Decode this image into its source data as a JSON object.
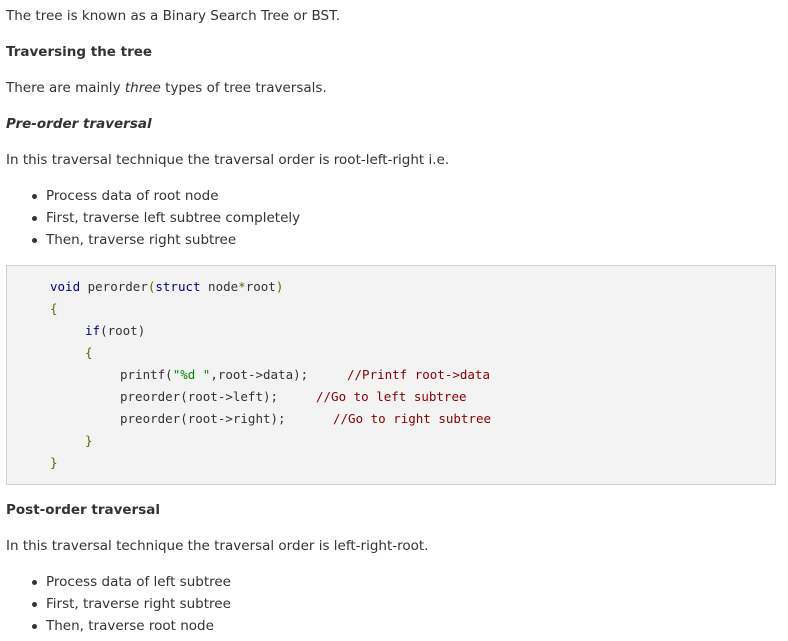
{
  "intro": {
    "text": "The tree is known as a Binary Search Tree or BST."
  },
  "traversing": {
    "heading": "Traversing the tree",
    "text_before": "There are mainly ",
    "text_em": "three",
    "text_after": " types of tree traversals."
  },
  "preorder": {
    "heading": "Pre-order traversal",
    "description": "In this traversal technique the traversal order is root-left-right i.e.",
    "bullets": [
      "Process data of root node",
      "First, traverse left subtree completely",
      "Then, traverse right subtree"
    ]
  },
  "code": {
    "sig_kw": "void",
    "sig_name": " perorder",
    "sig_paren_open": "(",
    "sig_struct": "struct",
    "sig_params": " node",
    "sig_star": "*",
    "sig_root": "root",
    "sig_paren_close": ")",
    "brace_open": "{",
    "if_kw": "if",
    "if_cond": "(root)",
    "inner_brace_open": "{",
    "printf_call": "printf(",
    "printf_str": "\"%d \"",
    "printf_args": ",root->data);",
    "printf_comment": "//Printf root->data",
    "left_call": "preorder(root->left);",
    "left_comment": "//Go to left subtree",
    "right_call": "preorder(root->right);",
    "right_comment": "//Go to right subtree",
    "inner_brace_close": "}",
    "brace_close": "}"
  },
  "postorder": {
    "heading": "Post-order traversal",
    "description": "In this traversal technique the traversal order is left-right-root.",
    "bullets": [
      "Process data of left subtree",
      "First, traverse right subtree",
      "Then, traverse root node"
    ]
  }
}
